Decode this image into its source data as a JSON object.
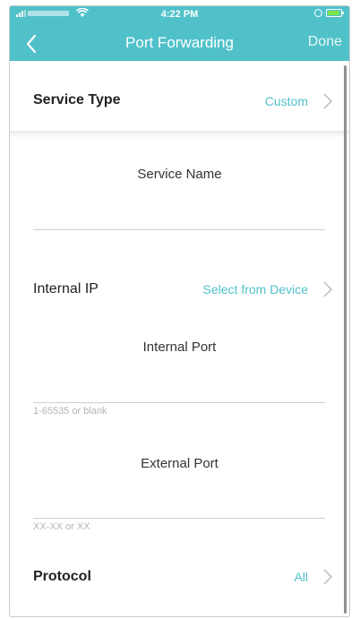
{
  "status": {
    "time": "4:22 PM"
  },
  "nav": {
    "title": "Port Forwarding",
    "done_label": "Done"
  },
  "service_type": {
    "label": "Service Type",
    "value": "Custom"
  },
  "service_name": {
    "label": "Service Name",
    "value": ""
  },
  "internal_ip": {
    "label": "Internal IP",
    "value": "Select from Device"
  },
  "internal_port": {
    "label": "Internal Port",
    "value": "",
    "hint": "1-65535 or blank"
  },
  "external_port": {
    "label": "External Port",
    "value": "",
    "hint": "XX-XX or XX"
  },
  "protocol": {
    "label": "Protocol",
    "value": "All"
  },
  "colors": {
    "accent": "#50c1c9",
    "battery": "#7be34a"
  },
  "icons": [
    "back-chevron-icon",
    "chevron-right-icon",
    "wifi-icon",
    "battery-icon",
    "signal-icon"
  ]
}
